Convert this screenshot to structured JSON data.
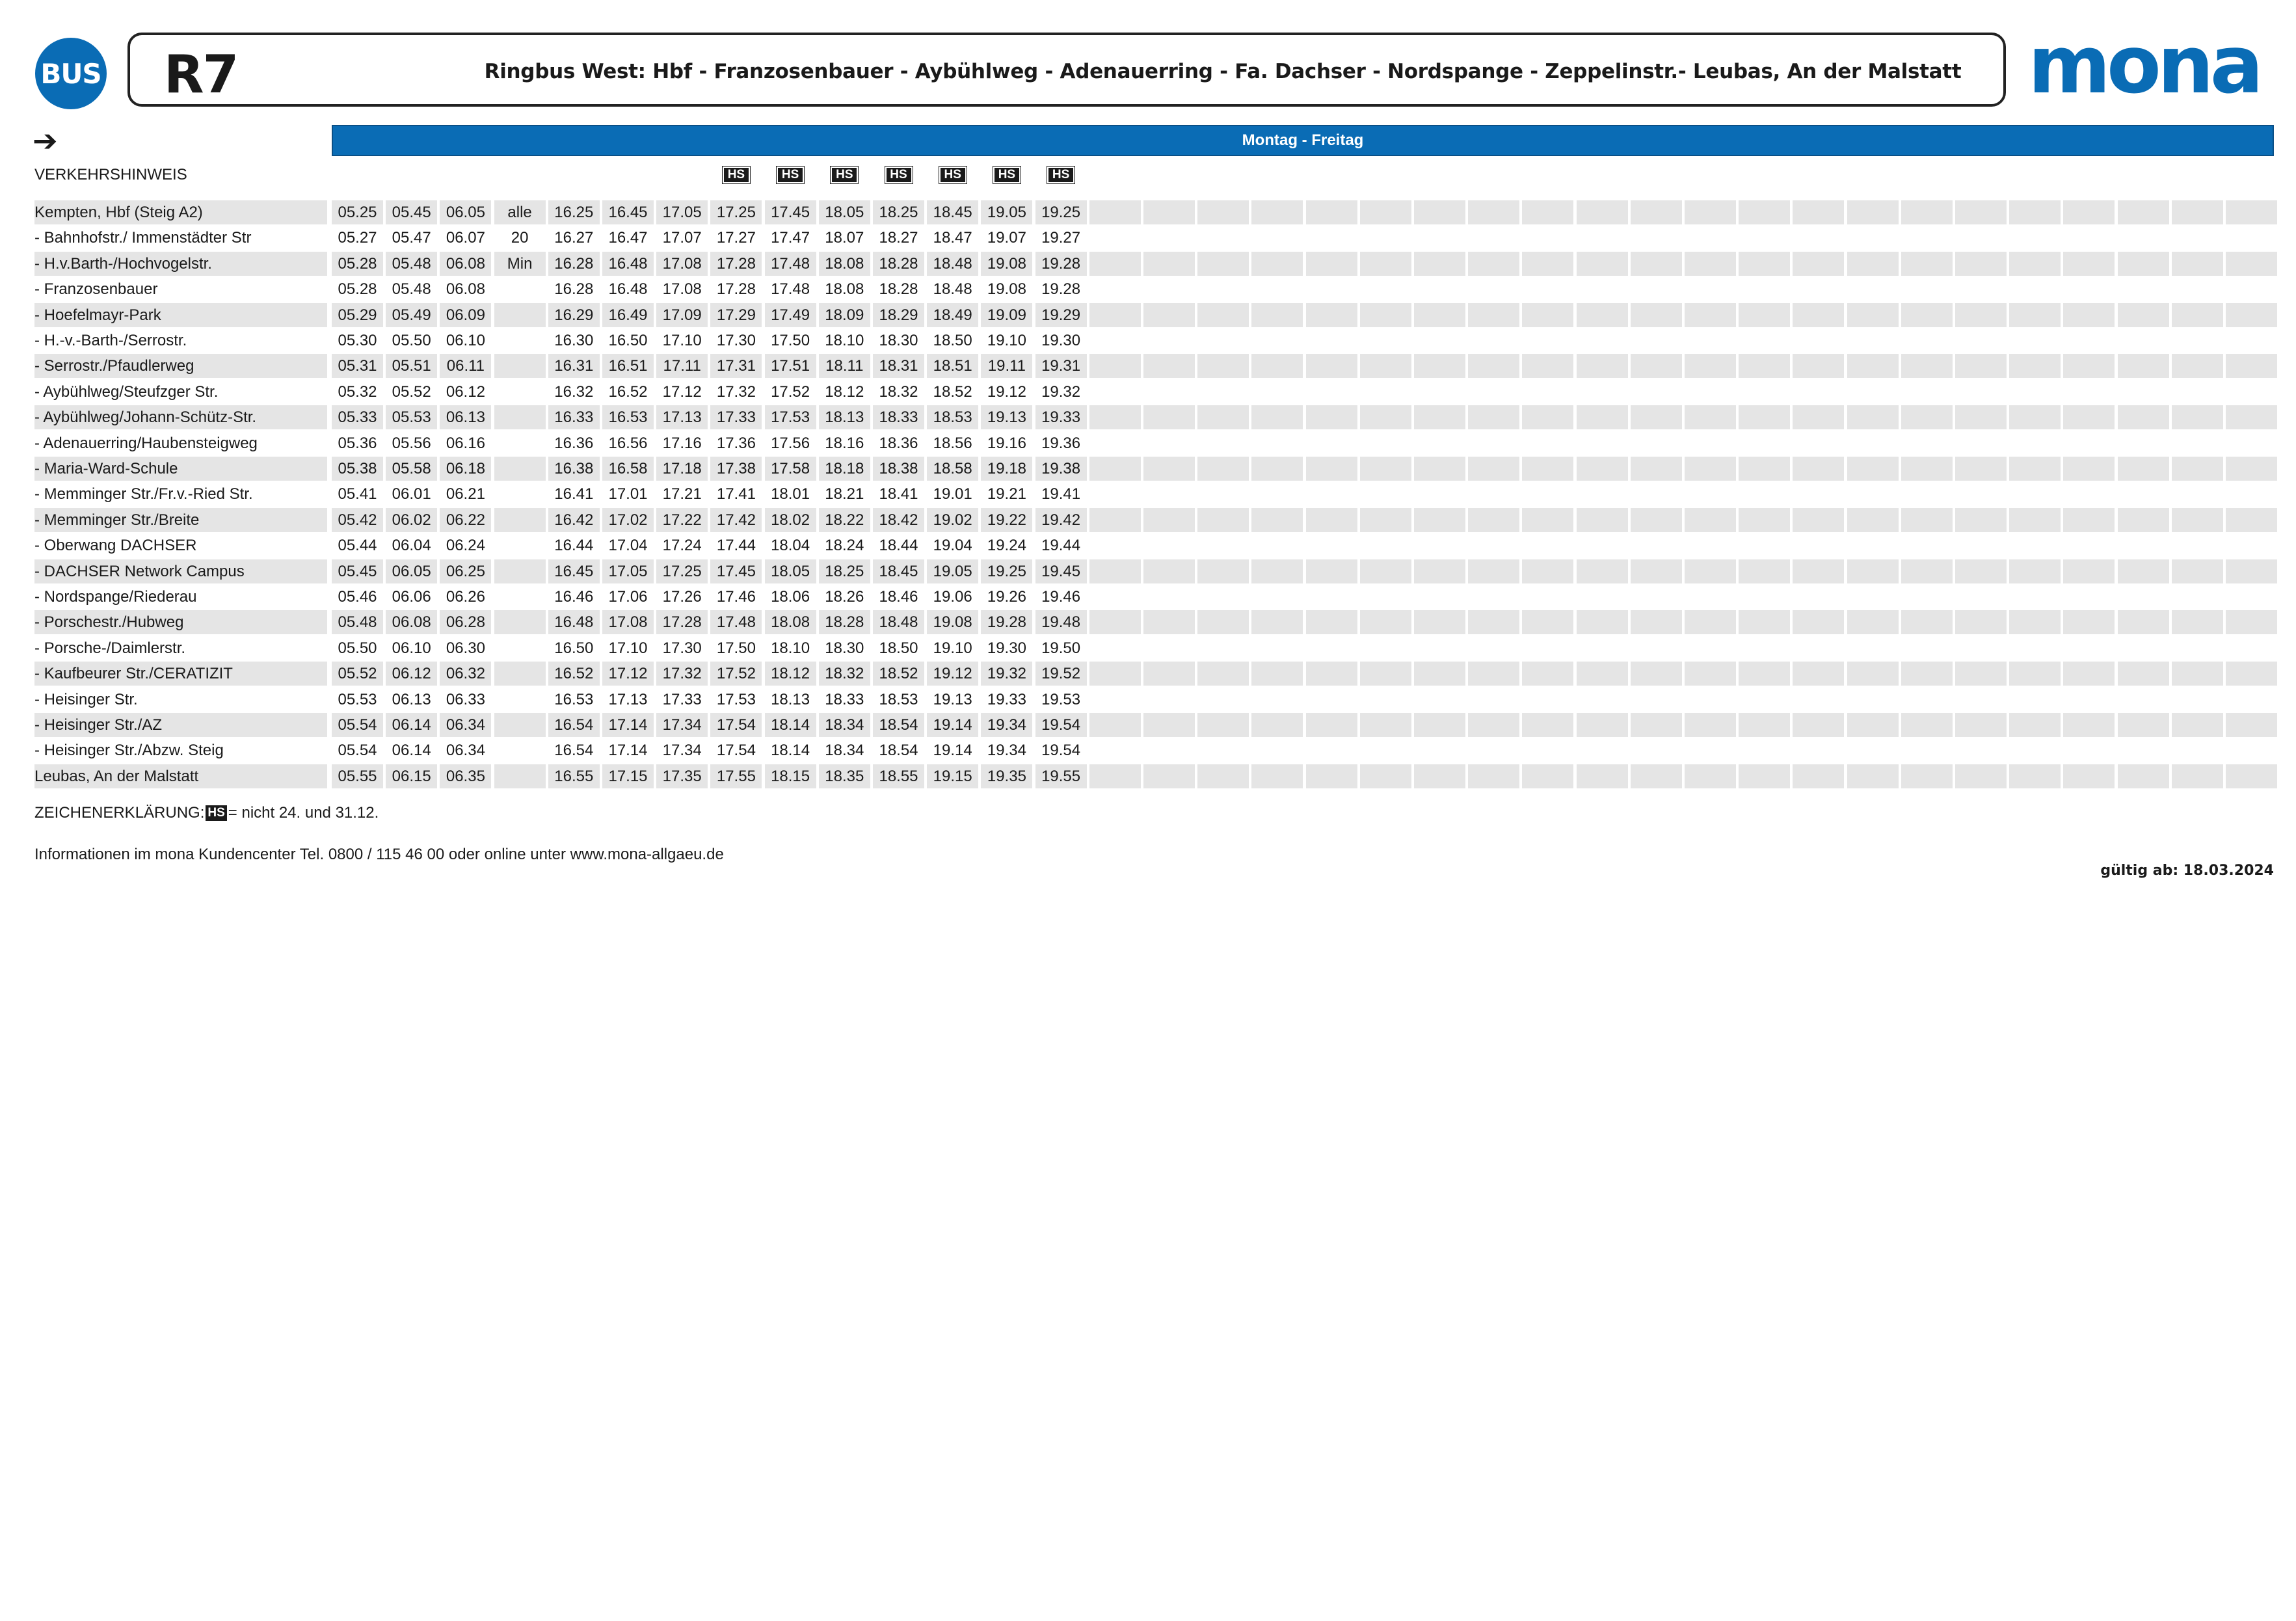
{
  "header": {
    "bus_label": "BUS",
    "line": "R7",
    "route": "Ringbus West: Hbf - Franzosenbauer - Aybühlweg - Adenauerring - Fa. Dachser - Nordspange - Zeppelinstr.- Leubas, An der Malstatt",
    "logo_text": "mona",
    "brand_color": "#0a6cb5"
  },
  "direction_icon": "right-arrow-icon",
  "day_band": "Montag - Freitag",
  "verkehrshinweis_label": "VERKEHRSHINWEIS",
  "notes": [
    "",
    "",
    "",
    "",
    "",
    "",
    "",
    "HS",
    "HS",
    "HS",
    "HS",
    "HS",
    "HS",
    "HS"
  ],
  "note_code": "HS",
  "stops": [
    {
      "name": "Kempten, Hbf (Steig A2)",
      "times": [
        "05.25",
        "05.45",
        "06.05",
        "alle",
        "16.25",
        "16.45",
        "17.05",
        "17.25",
        "17.45",
        "18.05",
        "18.25",
        "18.45",
        "19.05",
        "19.25"
      ]
    },
    {
      "name": "- Bahnhofstr./ Immenstädter Str",
      "times": [
        "05.27",
        "05.47",
        "06.07",
        "20",
        "16.27",
        "16.47",
        "17.07",
        "17.27",
        "17.47",
        "18.07",
        "18.27",
        "18.47",
        "19.07",
        "19.27"
      ]
    },
    {
      "name": "- H.v.Barth-/Hochvogelstr.",
      "times": [
        "05.28",
        "05.48",
        "06.08",
        "Min",
        "16.28",
        "16.48",
        "17.08",
        "17.28",
        "17.48",
        "18.08",
        "18.28",
        "18.48",
        "19.08",
        "19.28"
      ]
    },
    {
      "name": "- Franzosenbauer",
      "times": [
        "05.28",
        "05.48",
        "06.08",
        "",
        "16.28",
        "16.48",
        "17.08",
        "17.28",
        "17.48",
        "18.08",
        "18.28",
        "18.48",
        "19.08",
        "19.28"
      ]
    },
    {
      "name": "- Hoefelmayr-Park",
      "times": [
        "05.29",
        "05.49",
        "06.09",
        "",
        "16.29",
        "16.49",
        "17.09",
        "17.29",
        "17.49",
        "18.09",
        "18.29",
        "18.49",
        "19.09",
        "19.29"
      ]
    },
    {
      "name": "- H.-v.-Barth-/Serrostr.",
      "times": [
        "05.30",
        "05.50",
        "06.10",
        "",
        "16.30",
        "16.50",
        "17.10",
        "17.30",
        "17.50",
        "18.10",
        "18.30",
        "18.50",
        "19.10",
        "19.30"
      ]
    },
    {
      "name": "- Serrostr./Pfaudlerweg",
      "times": [
        "05.31",
        "05.51",
        "06.11",
        "",
        "16.31",
        "16.51",
        "17.11",
        "17.31",
        "17.51",
        "18.11",
        "18.31",
        "18.51",
        "19.11",
        "19.31"
      ]
    },
    {
      "name": "- Aybühlweg/Steufzger Str.",
      "times": [
        "05.32",
        "05.52",
        "06.12",
        "",
        "16.32",
        "16.52",
        "17.12",
        "17.32",
        "17.52",
        "18.12",
        "18.32",
        "18.52",
        "19.12",
        "19.32"
      ]
    },
    {
      "name": "- Aybühlweg/Johann-Schütz-Str.",
      "times": [
        "05.33",
        "05.53",
        "06.13",
        "",
        "16.33",
        "16.53",
        "17.13",
        "17.33",
        "17.53",
        "18.13",
        "18.33",
        "18.53",
        "19.13",
        "19.33"
      ]
    },
    {
      "name": "- Adenauerring/Haubensteigweg",
      "times": [
        "05.36",
        "05.56",
        "06.16",
        "",
        "16.36",
        "16.56",
        "17.16",
        "17.36",
        "17.56",
        "18.16",
        "18.36",
        "18.56",
        "19.16",
        "19.36"
      ]
    },
    {
      "name": "- Maria-Ward-Schule",
      "times": [
        "05.38",
        "05.58",
        "06.18",
        "",
        "16.38",
        "16.58",
        "17.18",
        "17.38",
        "17.58",
        "18.18",
        "18.38",
        "18.58",
        "19.18",
        "19.38"
      ]
    },
    {
      "name": "- Memminger Str./Fr.v.-Ried Str.",
      "times": [
        "05.41",
        "06.01",
        "06.21",
        "",
        "16.41",
        "17.01",
        "17.21",
        "17.41",
        "18.01",
        "18.21",
        "18.41",
        "19.01",
        "19.21",
        "19.41"
      ]
    },
    {
      "name": "- Memminger Str./Breite",
      "times": [
        "05.42",
        "06.02",
        "06.22",
        "",
        "16.42",
        "17.02",
        "17.22",
        "17.42",
        "18.02",
        "18.22",
        "18.42",
        "19.02",
        "19.22",
        "19.42"
      ]
    },
    {
      "name": "- Oberwang DACHSER",
      "times": [
        "05.44",
        "06.04",
        "06.24",
        "",
        "16.44",
        "17.04",
        "17.24",
        "17.44",
        "18.04",
        "18.24",
        "18.44",
        "19.04",
        "19.24",
        "19.44"
      ]
    },
    {
      "name": "- DACHSER Network Campus",
      "times": [
        "05.45",
        "06.05",
        "06.25",
        "",
        "16.45",
        "17.05",
        "17.25",
        "17.45",
        "18.05",
        "18.25",
        "18.45",
        "19.05",
        "19.25",
        "19.45"
      ]
    },
    {
      "name": "- Nordspange/Riederau",
      "times": [
        "05.46",
        "06.06",
        "06.26",
        "",
        "16.46",
        "17.06",
        "17.26",
        "17.46",
        "18.06",
        "18.26",
        "18.46",
        "19.06",
        "19.26",
        "19.46"
      ]
    },
    {
      "name": "- Porschestr./Hubweg",
      "times": [
        "05.48",
        "06.08",
        "06.28",
        "",
        "16.48",
        "17.08",
        "17.28",
        "17.48",
        "18.08",
        "18.28",
        "18.48",
        "19.08",
        "19.28",
        "19.48"
      ]
    },
    {
      "name": "- Porsche-/Daimlerstr.",
      "times": [
        "05.50",
        "06.10",
        "06.30",
        "",
        "16.50",
        "17.10",
        "17.30",
        "17.50",
        "18.10",
        "18.30",
        "18.50",
        "19.10",
        "19.30",
        "19.50"
      ]
    },
    {
      "name": "- Kaufbeurer Str./CERATIZIT",
      "times": [
        "05.52",
        "06.12",
        "06.32",
        "",
        "16.52",
        "17.12",
        "17.32",
        "17.52",
        "18.12",
        "18.32",
        "18.52",
        "19.12",
        "19.32",
        "19.52"
      ]
    },
    {
      "name": "- Heisinger Str.",
      "times": [
        "05.53",
        "06.13",
        "06.33",
        "",
        "16.53",
        "17.13",
        "17.33",
        "17.53",
        "18.13",
        "18.33",
        "18.53",
        "19.13",
        "19.33",
        "19.53"
      ]
    },
    {
      "name": "- Heisinger Str./AZ",
      "times": [
        "05.54",
        "06.14",
        "06.34",
        "",
        "16.54",
        "17.14",
        "17.34",
        "17.54",
        "18.14",
        "18.34",
        "18.54",
        "19.14",
        "19.34",
        "19.54"
      ]
    },
    {
      "name": "- Heisinger Str./Abzw. Steig",
      "times": [
        "05.54",
        "06.14",
        "06.34",
        "",
        "16.54",
        "17.14",
        "17.34",
        "17.54",
        "18.14",
        "18.34",
        "18.54",
        "19.14",
        "19.34",
        "19.54"
      ]
    },
    {
      "name": "Leubas, An der Malstatt",
      "times": [
        "05.55",
        "06.15",
        "06.35",
        "",
        "16.55",
        "17.15",
        "17.35",
        "17.55",
        "18.15",
        "18.35",
        "18.55",
        "19.15",
        "19.35",
        "19.55"
      ]
    }
  ],
  "legend": {
    "prefix": "ZEICHENERKLÄRUNG:",
    "code": "HS",
    "text": "= nicht 24. und 31.12."
  },
  "info": "Informationen im mona Kundencenter Tel. 0800 / 115 46 00 oder online unter www.mona-allgaeu.de",
  "valid_from": "gültig ab: 18.03.2024"
}
